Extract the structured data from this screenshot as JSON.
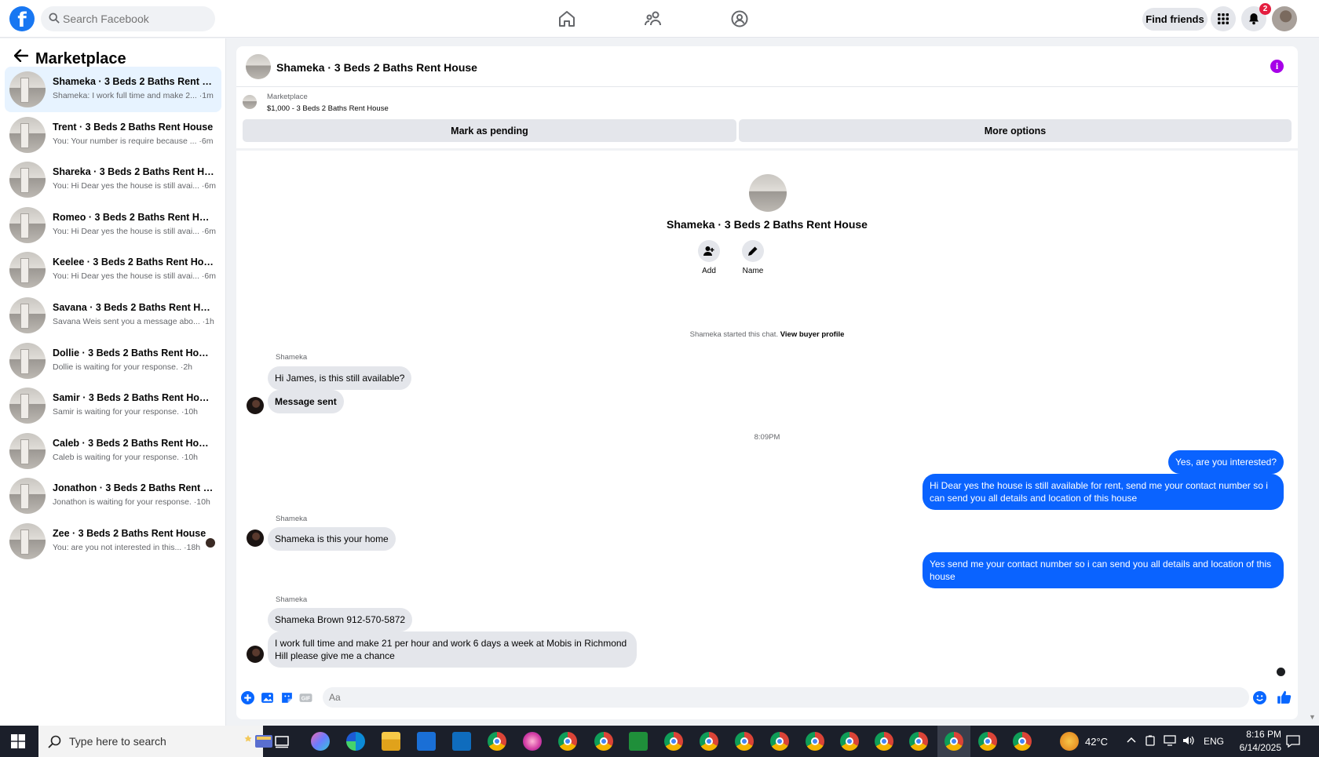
{
  "topbar": {
    "search_placeholder": "Search Facebook",
    "find_friends": "Find friends",
    "notification_count": "2"
  },
  "sidebar": {
    "title": "Marketplace",
    "conversations": [
      {
        "name": "Shameka · 3 Beds 2 Baths Rent Ho...",
        "preview": "Shameka: I work full time and make 2... ·1m"
      },
      {
        "name": "Trent · 3 Beds 2 Baths Rent House",
        "preview": "You: Your number is require because ... ·6m"
      },
      {
        "name": "Shareka · 3 Beds 2 Baths Rent House",
        "preview": "You: Hi Dear yes the house is still avai... ·6m"
      },
      {
        "name": "Romeo · 3 Beds 2 Baths Rent House",
        "preview": "You: Hi Dear yes the house is still avai... ·6m"
      },
      {
        "name": "Keelee · 3 Beds 2 Baths Rent House",
        "preview": "You: Hi Dear yes the house is still avai... ·6m"
      },
      {
        "name": "Savana · 3 Beds 2 Baths Rent House",
        "preview": "Savana Weis sent you a message abo... ·1h"
      },
      {
        "name": "Dollie · 3 Beds 2 Baths Rent House",
        "preview": "Dollie is waiting for your response. ·2h"
      },
      {
        "name": "Samir · 3 Beds 2 Baths Rent House",
        "preview": "Samir is waiting for your response. ·10h"
      },
      {
        "name": "Caleb · 3 Beds 2 Baths Rent House",
        "preview": "Caleb is waiting for your response. ·10h"
      },
      {
        "name": "Jonathon · 3 Beds 2 Baths Rent Ho...",
        "preview": "Jonathon is waiting for your response. ·10h"
      },
      {
        "name": "Zee · 3 Beds 2 Baths Rent House",
        "preview": "You: are you not interested in this... ·18h"
      }
    ]
  },
  "chat": {
    "title": "Shameka · 3 Beds 2 Baths Rent House",
    "listing_category": "Marketplace",
    "listing_price": "$1,000 - 3 Beds 2 Baths Rent House",
    "mark_pending": "Mark as pending",
    "more_options": "More options",
    "profile_name": "Shameka · 3 Beds 2 Baths Rent House",
    "add_label": "Add",
    "name_label": "Name",
    "started_text": "Shameka started this chat.",
    "view_buyer": "View buyer profile",
    "timestamp": "8:09PM",
    "messages": {
      "sender1": "Shameka",
      "m1": "Hi James, is this still available?",
      "m2": "Message sent",
      "out1": "Yes, are you interested?",
      "out2": "Hi Dear yes the house is still available for rent, send me your contact number so i can send you all details and location of this house",
      "sender2": "Shameka",
      "m3": "Shameka is this your home",
      "out3": "Yes  send me your contact number so i can send you all details and location of this house",
      "sender3": "Shameka",
      "m4": "Shameka Brown 912-570-5872",
      "m5": "I work full time and make 21 per hour and work 6 days a week at Mobis in Richmond Hill please give me a chance"
    },
    "composer_placeholder": "Aa"
  },
  "taskbar": {
    "search_text": "Type here to search",
    "temperature": "42°C",
    "language": "ENG",
    "time": "8:16 PM",
    "date": "6/14/2025"
  },
  "colors": {
    "facebook_blue": "#1877f2",
    "outgoing_bubble": "#0a63ff",
    "incoming_bubble": "#e4e6eb",
    "info_purple": "#a700e8"
  }
}
